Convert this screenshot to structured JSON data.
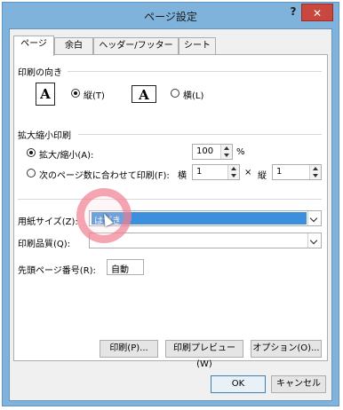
{
  "window": {
    "title": "ページ設定",
    "help_label": "?",
    "close_label": "✕"
  },
  "tabs": [
    {
      "label": "ページ"
    },
    {
      "label": "余白"
    },
    {
      "label": "ヘッダー/フッター"
    },
    {
      "label": "シート"
    }
  ],
  "orientation": {
    "heading": "印刷の向き",
    "icon_letter": "A",
    "portrait_label": "縦(T)",
    "landscape_label": "横(L)",
    "selected": "portrait"
  },
  "scaling": {
    "heading": "拡大縮小印刷",
    "zoom_label": "拡大/縮小(A):",
    "zoom_value": "100",
    "zoom_unit": "%",
    "fit_label": "次のページ数に合わせて印刷(F):",
    "wide_label": "横",
    "wide_value": "1",
    "times": "×",
    "tall_label": "縦",
    "tall_value": "1",
    "selected": "zoom"
  },
  "paper": {
    "size_label": "用紙サイズ(Z):",
    "size_value": "はがき",
    "quality_label": "印刷品質(Q):",
    "quality_value": "",
    "first_page_label": "先頭ページ番号(R):",
    "first_page_value": "自動"
  },
  "buttons": {
    "print": "印刷(P)...",
    "preview": "印刷プレビュー(W)",
    "options": "オプション(O)...",
    "ok": "OK",
    "cancel": "キャンセル"
  },
  "colors": {
    "titlebar": "#7fb3dc",
    "close": "#c8473f",
    "selection": "#3c8fdd",
    "highlight_ring": "#f0788c"
  }
}
